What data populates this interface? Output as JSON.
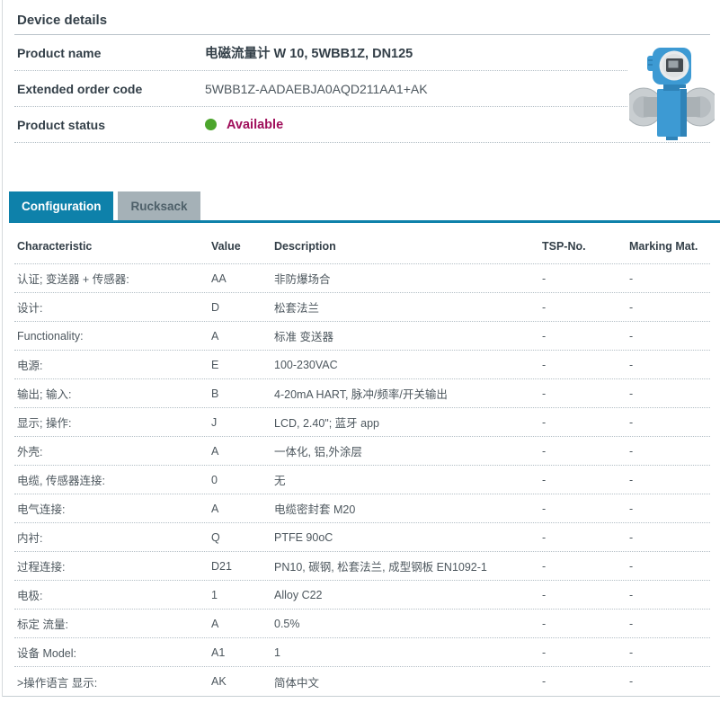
{
  "device_details": {
    "title": "Device details",
    "product_name_label": "Product name",
    "product_name_cn": "电磁流量计",
    "product_name_rest": " W 10, 5WBB1Z, DN125",
    "extended_order_code_label": "Extended order code",
    "extended_order_code": "5WBB1Z-AADAEBJA0AQD211AA1+AK",
    "product_status_label": "Product status",
    "product_status": "Available"
  },
  "tabs": {
    "configuration": "Configuration",
    "rucksack": "Rucksack"
  },
  "table": {
    "headers": {
      "characteristic": "Characteristic",
      "value": "Value",
      "description": "Description",
      "tsp_no": "TSP-No.",
      "marking_mat": "Marking Mat."
    },
    "rows": [
      {
        "characteristic": "认证; 变送器 + 传感器:",
        "value": "AA",
        "description": "非防爆场合",
        "tsp_no": "-",
        "marking_mat": "-"
      },
      {
        "characteristic": "设计:",
        "value": "D",
        "description": "松套法兰",
        "tsp_no": "-",
        "marking_mat": "-"
      },
      {
        "characteristic": "Functionality:",
        "value": "A",
        "description": "标准 变送器",
        "tsp_no": "-",
        "marking_mat": "-"
      },
      {
        "characteristic": "电源:",
        "value": "E",
        "description": "100-230VAC",
        "tsp_no": "-",
        "marking_mat": "-"
      },
      {
        "characteristic": "输出; 输入:",
        "value": "B",
        "description": "4-20mA HART, 脉冲/频率/开关输出",
        "tsp_no": "-",
        "marking_mat": "-"
      },
      {
        "characteristic": "显示; 操作:",
        "value": "J",
        "description": "LCD, 2.40\"; 蓝牙 app",
        "tsp_no": "-",
        "marking_mat": "-"
      },
      {
        "characteristic": "外壳:",
        "value": "A",
        "description": "一体化, 铝,外涂层",
        "tsp_no": "-",
        "marking_mat": "-"
      },
      {
        "characteristic": "电缆, 传感器连接:",
        "value": "0",
        "description": "无",
        "tsp_no": "-",
        "marking_mat": "-"
      },
      {
        "characteristic": "电气连接:",
        "value": "A",
        "description": "电缆密封套 M20",
        "tsp_no": "-",
        "marking_mat": "-"
      },
      {
        "characteristic": "内衬:",
        "value": "Q",
        "description": "PTFE 90oC",
        "tsp_no": "-",
        "marking_mat": "-"
      },
      {
        "characteristic": "过程连接:",
        "value": "D21",
        "description": "PN10, 碳钢, 松套法兰, 成型钢板 EN1092-1",
        "tsp_no": "-",
        "marking_mat": "-"
      },
      {
        "characteristic": "电极:",
        "value": "1",
        "description": "Alloy C22",
        "tsp_no": "-",
        "marking_mat": "-"
      },
      {
        "characteristic": "标定 流量:",
        "value": "A",
        "description": "0.5%",
        "tsp_no": "-",
        "marking_mat": "-"
      },
      {
        "characteristic": "设备 Model:",
        "value": "A1",
        "description": "1",
        "tsp_no": "-",
        "marking_mat": "-"
      },
      {
        "characteristic": ">操作语言 显示:",
        "value": "AK",
        "description": "简体中文",
        "tsp_no": "-",
        "marking_mat": "-"
      }
    ]
  },
  "colors": {
    "accent_blue": "#0e81aa",
    "inactive_tab_gray": "#a5b1b7",
    "status_green": "#4ca52c",
    "status_magenta": "#a0105c"
  },
  "icons": {
    "product_image": "electromagnetic-flowmeter"
  }
}
